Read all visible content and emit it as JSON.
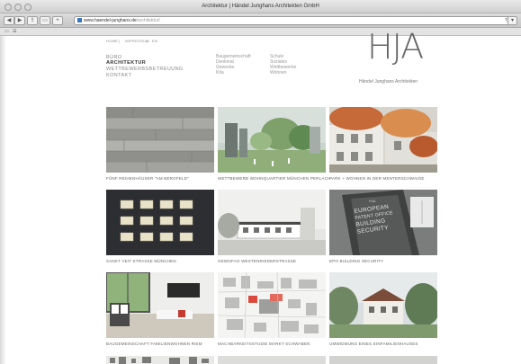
{
  "window": {
    "title": "Architektur | Händel Junghans Architekten GmbH",
    "url_domain": "www.haendel-junghans.de",
    "url_path": "/architektur/",
    "bookmarks": [
      "▭",
      "☰"
    ]
  },
  "lang": [
    "HOME",
    "IMPRESSUM",
    "EN"
  ],
  "nav": {
    "main": [
      "BÜRO",
      "ARCHITEKTUR",
      "WETTBEWERBSBETREUUNG",
      "KONTAKT"
    ],
    "active_index": 1,
    "sub_col1": [
      "Baugemeinschaft",
      "Denkmal",
      "Gewerbe",
      "Kita"
    ],
    "sub_col2": [
      "Schule",
      "Soziales",
      "Wettbewerbe",
      "Wohnen"
    ]
  },
  "logo": {
    "mark": "HJA",
    "name": "Händel Junghans Architekten"
  },
  "projects": [
    {
      "caption": "FÜNF REIHENHÄUSER \"AM BERGFELD\""
    },
    {
      "caption": "WETTBEWERB WOHNQUARTIER MÜNCHEN PERLACH"
    },
    {
      "caption": "PARK + WOHNEN IN DER MENTERSCHWAIGE"
    },
    {
      "caption": "SANKT VEIT STRASSE MÜNCHEN"
    },
    {
      "caption": "GEWOFAG WESTENRIEDERSTRASSE"
    },
    {
      "caption": "EPO BUILDING SECURITY",
      "sign": [
        "EUROPEAN",
        "PATENT OFFICE",
        "BUILDING",
        "SECURITY"
      ]
    },
    {
      "caption": "BAUGEMEINSCHAFT FAMILIENWOHNEN RIEM"
    },
    {
      "caption": "MACHBARKEITSSTUDIE MARKT SCHWABEN"
    },
    {
      "caption": "UMWIDMUNG EINES EINFAMILIENHAUSES"
    }
  ],
  "colors": {
    "background": "#ffffff",
    "text": "#666666",
    "chrome": "#d6d6d6"
  }
}
